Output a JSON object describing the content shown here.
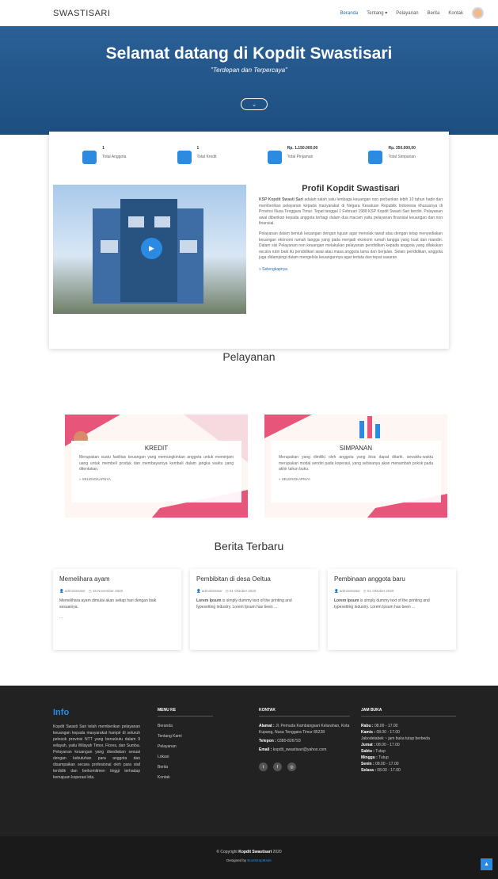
{
  "nav": {
    "brand": "SWASTISARI",
    "items": [
      "Beranda",
      "Tentang ▾",
      "Pelayanan",
      "Berita",
      "Kontak"
    ]
  },
  "hero": {
    "title": "Selamat datang di Kopdit Swastisari",
    "subtitle": "\"Terdepan dan Terpercaya\"",
    "down_icon": "chevron-down-icon"
  },
  "stats": [
    {
      "value": "1",
      "label": "Total Anggota",
      "icon": "users-icon"
    },
    {
      "value": "1",
      "label": "Total Kredit",
      "icon": "card-icon"
    },
    {
      "value": "Rp. 1.150.000,00",
      "label": "Total Pinjaman",
      "icon": "money-bag-icon"
    },
    {
      "value": "Rp. 350.000,00",
      "label": "Total Simpanan",
      "icon": "wallet-icon"
    }
  ],
  "profil": {
    "title": "Profil Kopdit Swastisari",
    "p1_bold": "KSP Kopdit Swasti Sari",
    "p1": " adalah salah satu lembaga keuangan non perbankan lebih 10 tahun hadir dan memberikan pelayanan kepada masyarakat di Negara Kesatuan Republik Indonesia khususnya di Provinsi Nusa Tenggara Timur. Tepat tanggal 1 Februari 1988 KSP Kopdit Swasti Sari berdiri. Pelayanan awal diberikan kepada anggota terbagi dalam dua macam yaitu pelayanan finansial keuangan dan non finansial.",
    "p2": "Pelayanan dalam bentuk keuangan dengan tujuan agar menolak tawaf atau dengan tetap menyediakan keuangan ekonomi rumah tangga yang pada menjadi ekonomi rumah tangga yang kuat dan mandiri. Dalam sisi Pelayanan non keuangan melakukan pelayanan pendidikan kepada anggota yang dilakukan secara rutin baik itu pendidikan awal atau masa anggota lama dan berjalan. Selain pendidikan, anggota juga didampingi dalam mengelola keuangannya agar tertata dan tepat sasaran.",
    "more": "» Selengkapnya"
  },
  "pelayanan": {
    "title": "Pelayanan",
    "items": [
      {
        "title": "KREDIT",
        "text": "Merupakan suatu fasilitas keuangan yang memungkinkan anggota untuk meminjam uang untuk membeli produk dan membayarnya kembali dalam jangka waktu yang ditentukan.",
        "more": "» SELENGKAPNYA"
      },
      {
        "title": "SIMPANAN",
        "text": "Merupakan yang dimiliki oleh anggota yang bisa dapat ditarik, sewaktu-waktu merupakan modal sendiri pada koperasi, yang sebisanya akan menambah pokok pada akhir tahun buku.",
        "more": "» SELENGKAPNYA"
      }
    ]
  },
  "berita": {
    "title": "Berita Terbaru",
    "items": [
      {
        "title": "Memelihara ayam",
        "author": "administrator",
        "date": "15 November 2020",
        "text": "Memelihara ayam dimulai akan setiap hari dengan baik sesuainya.",
        "extra": "..."
      },
      {
        "title": "Pembibitan di desa Oeltua",
        "author": "administrator",
        "date": "01 Oktober 2020",
        "text_bold": "Lorem Ipsum",
        "text": " is simply dummy text of the printing and typesetting industry. Lorem Ipsum has been ..."
      },
      {
        "title": "Pembinaan anggota baru",
        "author": "administrator",
        "date": "01 Oktober 2020",
        "text_bold": "Lorem Ipsum",
        "text": " is simply dummy text of the printing and typesetting industry. Lorem Ipsum has been ..."
      }
    ]
  },
  "footer": {
    "info_title": "Info",
    "info_text": "Kopdit Swasti Sari telah memberikan pelayanan keuangan kepada masyarakat hampir di seluruh pelosok provinsi NTT yang bersekutu dalam 9 wilayah, yaitu Wilayah Timor, Flores, dan Sumba. Pelayanan keuangan yang disediakan sesuai dengan kebutuhan para anggota dan disampaikan secara profesional oleh para staf terdidik dan berkomitmen tinggi terhadap kemajuan koperasi kita.",
    "menu_title": "MENU KE",
    "menu_items": [
      "Beranda",
      "Tentang Kami",
      "Pelayanan",
      "Lokasi",
      "Berita",
      "Kontak"
    ],
    "kontak_title": "KONTAK",
    "kontak_alamat_label": "Alamat :",
    "kontak_alamat": " Jl. Pemuda Kambangsari Kelurahan, Kota Kupang, Nusa Tenggara Timur 85228",
    "kontak_telp_label": "Telepon :",
    "kontak_telp": " 0380-826793",
    "kontak_email_label": "Email :",
    "kontak_email": " kopdit_swastisari@yahoo.com",
    "jam_title": "JAM BUKA",
    "jam": [
      {
        "day": "Rabu :",
        "time": " 08.00 - 17.00"
      },
      {
        "day": "Kamis :",
        "time": " 08.00 - 17.00"
      },
      {
        "day": "Jumat :",
        "time": " 08.00 - 17.00"
      },
      {
        "day": "Sabtu :",
        "time": " Tutup"
      },
      {
        "day": "Minggu :",
        "time": " Tutup"
      },
      {
        "day": "Senin :",
        "time": " 08.00 - 17.00"
      },
      {
        "day": "Selasa :",
        "time": " 08.00 - 17.00"
      }
    ],
    "jam_note": "Jabodetabek ~ jam buka tutup berbeda",
    "social_icons": [
      "twitter-icon",
      "facebook-icon",
      "instagram-icon"
    ]
  },
  "copyright": {
    "line1_pre": "© Copyright ",
    "line1_bold": "Kopdit Swastisari",
    "line1_post": " 2020",
    "line2_pre": "Designed by ",
    "line2_link": "BootstrapMade"
  },
  "colors": {
    "accent": "#2b8be3",
    "hero": "#1f5287",
    "footer": "#222222"
  }
}
